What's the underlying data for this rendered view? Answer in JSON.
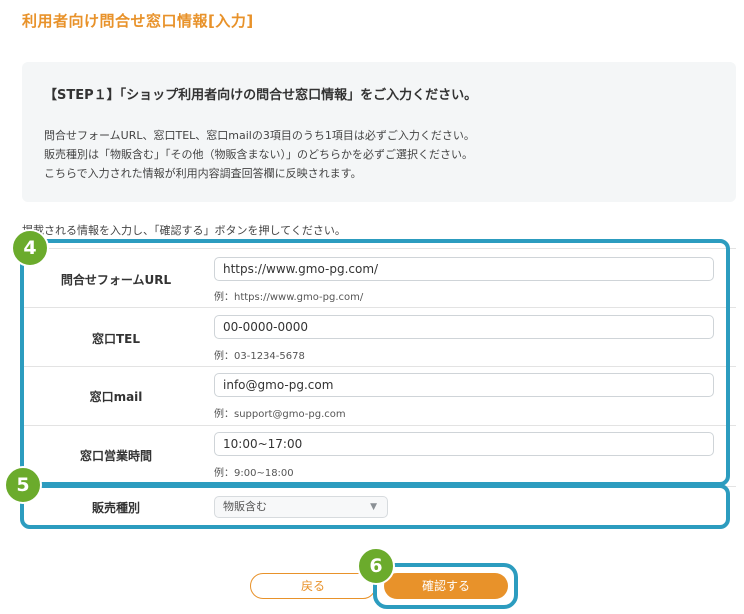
{
  "page": {
    "title": "利用者向け問合せ窓口情報[入力]"
  },
  "info": {
    "heading": "【STEP１】「ショップ利用者向けの問合せ窓口情報」をご入力ください。",
    "lines": [
      "問合せフォームURL、窓口TEL、窓口mailの3項目のうち1項目は必ずご入力ください。",
      "販売種別は「物販含む」「その他（物販含まない）」のどちらかを必ずご選択ください。",
      "こちらで入力された情報が利用内容調査回答欄に反映されます。"
    ]
  },
  "instruction": "掲載される情報を入力し、「確認する」ボタンを押してください。",
  "form": {
    "rows": [
      {
        "label": "問合せフォームURL",
        "value": "https://www.gmo-pg.com/",
        "example": "例：https://www.gmo-pg.com/"
      },
      {
        "label": "窓口TEL",
        "value": "00-0000-0000",
        "example": "例：03-1234-5678"
      },
      {
        "label": "窓口mail",
        "value": "info@gmo-pg.com",
        "example": "例：support@gmo-pg.com"
      },
      {
        "label": "窓口営業時間",
        "value": "10:00~17:00",
        "example": "例：9:00~18:00"
      }
    ],
    "sales_type": {
      "label": "販売種別",
      "selected": "物販含む"
    }
  },
  "buttons": {
    "back": "戻る",
    "confirm": "確認する"
  },
  "steps": {
    "four": "4",
    "five": "5",
    "six": "6"
  },
  "colors": {
    "accent": "#e8922a",
    "highlight": "#2c9cbf",
    "badge": "#6bab2c",
    "panel": "#f4f6f7"
  }
}
